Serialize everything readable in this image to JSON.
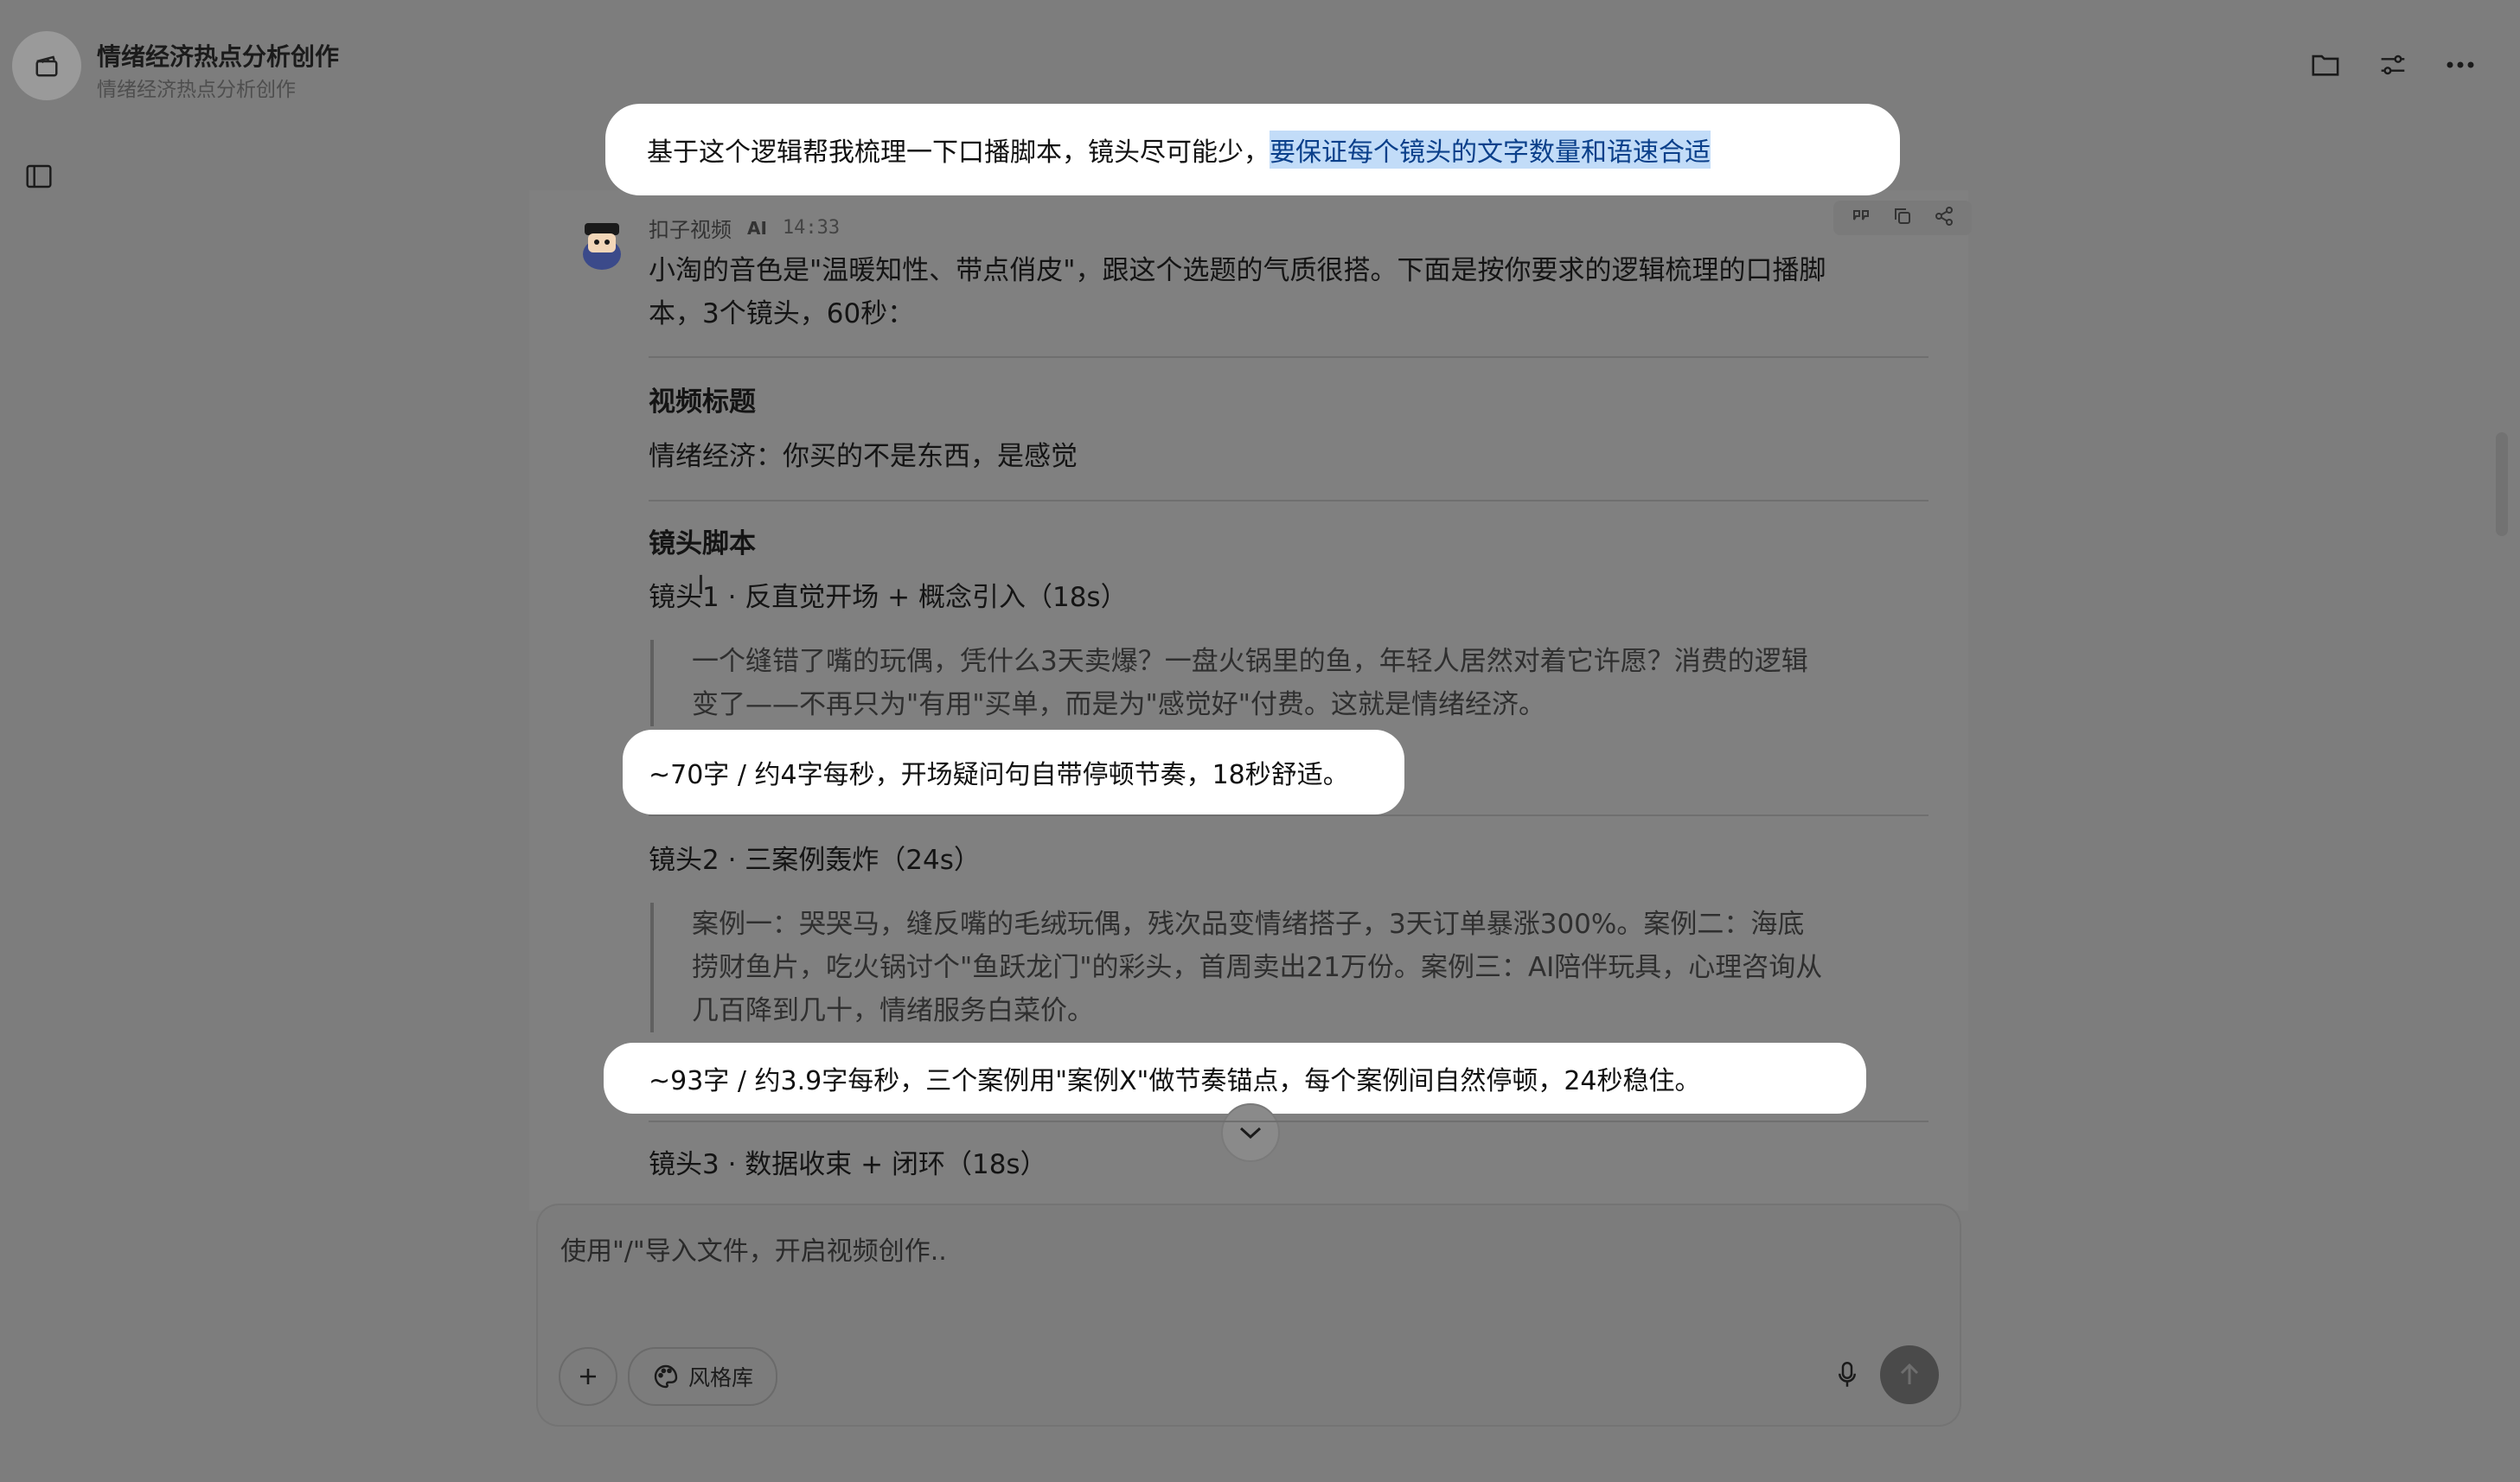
{
  "header": {
    "title": "情绪经济热点分析创作",
    "subtitle": "情绪经济热点分析创作",
    "icons": [
      "app-icon",
      "folder-icon",
      "settings-sliders-icon",
      "more-icon",
      "sidebar-toggle-icon"
    ]
  },
  "user_message": {
    "text": "基于这个逻辑帮我梳理一下口播脚本，镜头尽可能少，",
    "highlighted": "要保证每个镜头的文字数量和语速合适"
  },
  "assistant": {
    "name": "扣子视频",
    "tag": "AI",
    "time": "14:33",
    "intro_line1": "小淘的音色是\"温暖知性、带点俏皮\"，跟这个选题的气质很搭。下面是按你要求的逻辑梳理的口播脚",
    "intro_line2": "本，3个镜头，60秒：",
    "video_title_heading": "视频标题",
    "video_title": "情绪经济：你买的不是东西，是感觉",
    "script_heading": "镜头脚本",
    "shots": [
      {
        "title": "镜头1 · 反直觉开场 + 概念引入（18s）",
        "quote_lines": [
          "一个缝错了嘴的玩偶，凭什么3天卖爆？一盘火锅里的鱼，年轻人居然对着它许愿？消费的逻辑",
          "变了——不再只为\"有用\"买单，而是为\"感觉好\"付费。这就是情绪经济。"
        ],
        "note": "~70字 / 约4字每秒，开场疑问句自带停顿节奏，18秒舒适。"
      },
      {
        "title": "镜头2 · 三案例轰炸（24s）",
        "quote_lines": [
          "案例一：哭哭马，缝反嘴的毛绒玩偶，残次品变情绪搭子，3天订单暴涨300%。案例二：海底",
          "捞财鱼片，吃火锅讨个\"鱼跃龙门\"的彩头，首周卖出21万份。案例三：AI陪伴玩具，心理咨询从",
          "几百降到几十，情绪服务白菜价。"
        ],
        "note": "~93字 / 约3.9字每秒，三个案例用\"案例X\"做节奏锚点，每个案例间自然停顿，24秒稳住。"
      },
      {
        "title": "镜头3 · 数据收束 + 闭环（18s）"
      }
    ]
  },
  "composer": {
    "placeholder": "使用\"/\"导入文件，开启视频创作..",
    "style_library_label": "风格库"
  }
}
